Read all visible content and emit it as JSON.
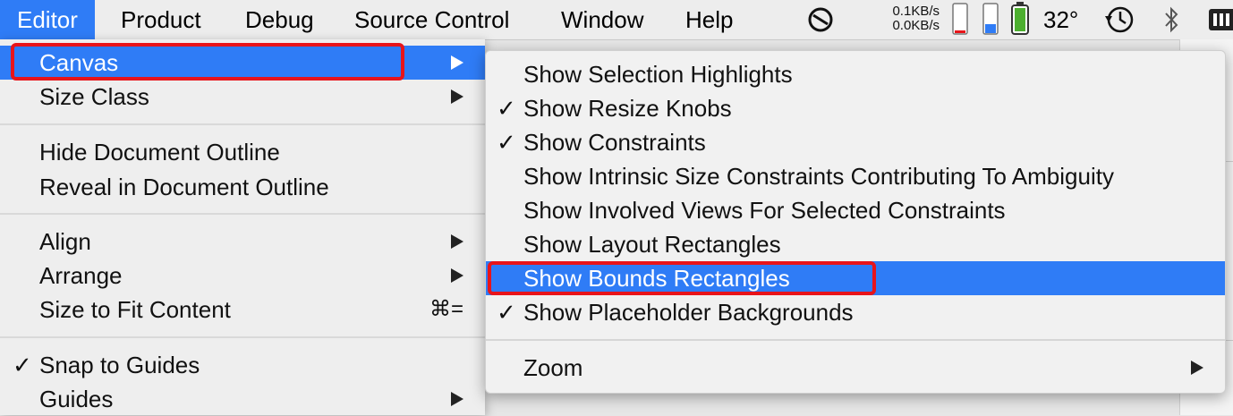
{
  "menubar": {
    "items": [
      "Editor",
      "Product",
      "Debug",
      "Source Control",
      "Window",
      "Help"
    ],
    "net_up": "0.1KB/s",
    "net_down": "0.0KB/s",
    "temperature": "32°"
  },
  "editor_menu": {
    "canvas": "Canvas",
    "size_class": "Size Class",
    "hide_outline": "Hide Document Outline",
    "reveal_outline": "Reveal in Document Outline",
    "align": "Align",
    "arrange": "Arrange",
    "size_to_fit": "Size to Fit Content",
    "size_to_fit_shortcut": "⌘=",
    "snap": "Snap to Guides",
    "guides": "Guides"
  },
  "canvas_submenu": {
    "selection_highlights": "Show Selection Highlights",
    "resize_knobs": "Show Resize Knobs",
    "constraints": "Show Constraints",
    "intrinsic": "Show Intrinsic Size Constraints Contributing To Ambiguity",
    "involved_views": "Show Involved Views For Selected Constraints",
    "layout_rects": "Show Layout Rectangles",
    "bounds_rects": "Show Bounds Rectangles",
    "placeholder_bg": "Show Placeholder Backgrounds",
    "zoom": "Zoom"
  },
  "checkmark": "✓",
  "colors": {
    "highlight": "#2f7cf6",
    "annotation": "#e8141a"
  }
}
